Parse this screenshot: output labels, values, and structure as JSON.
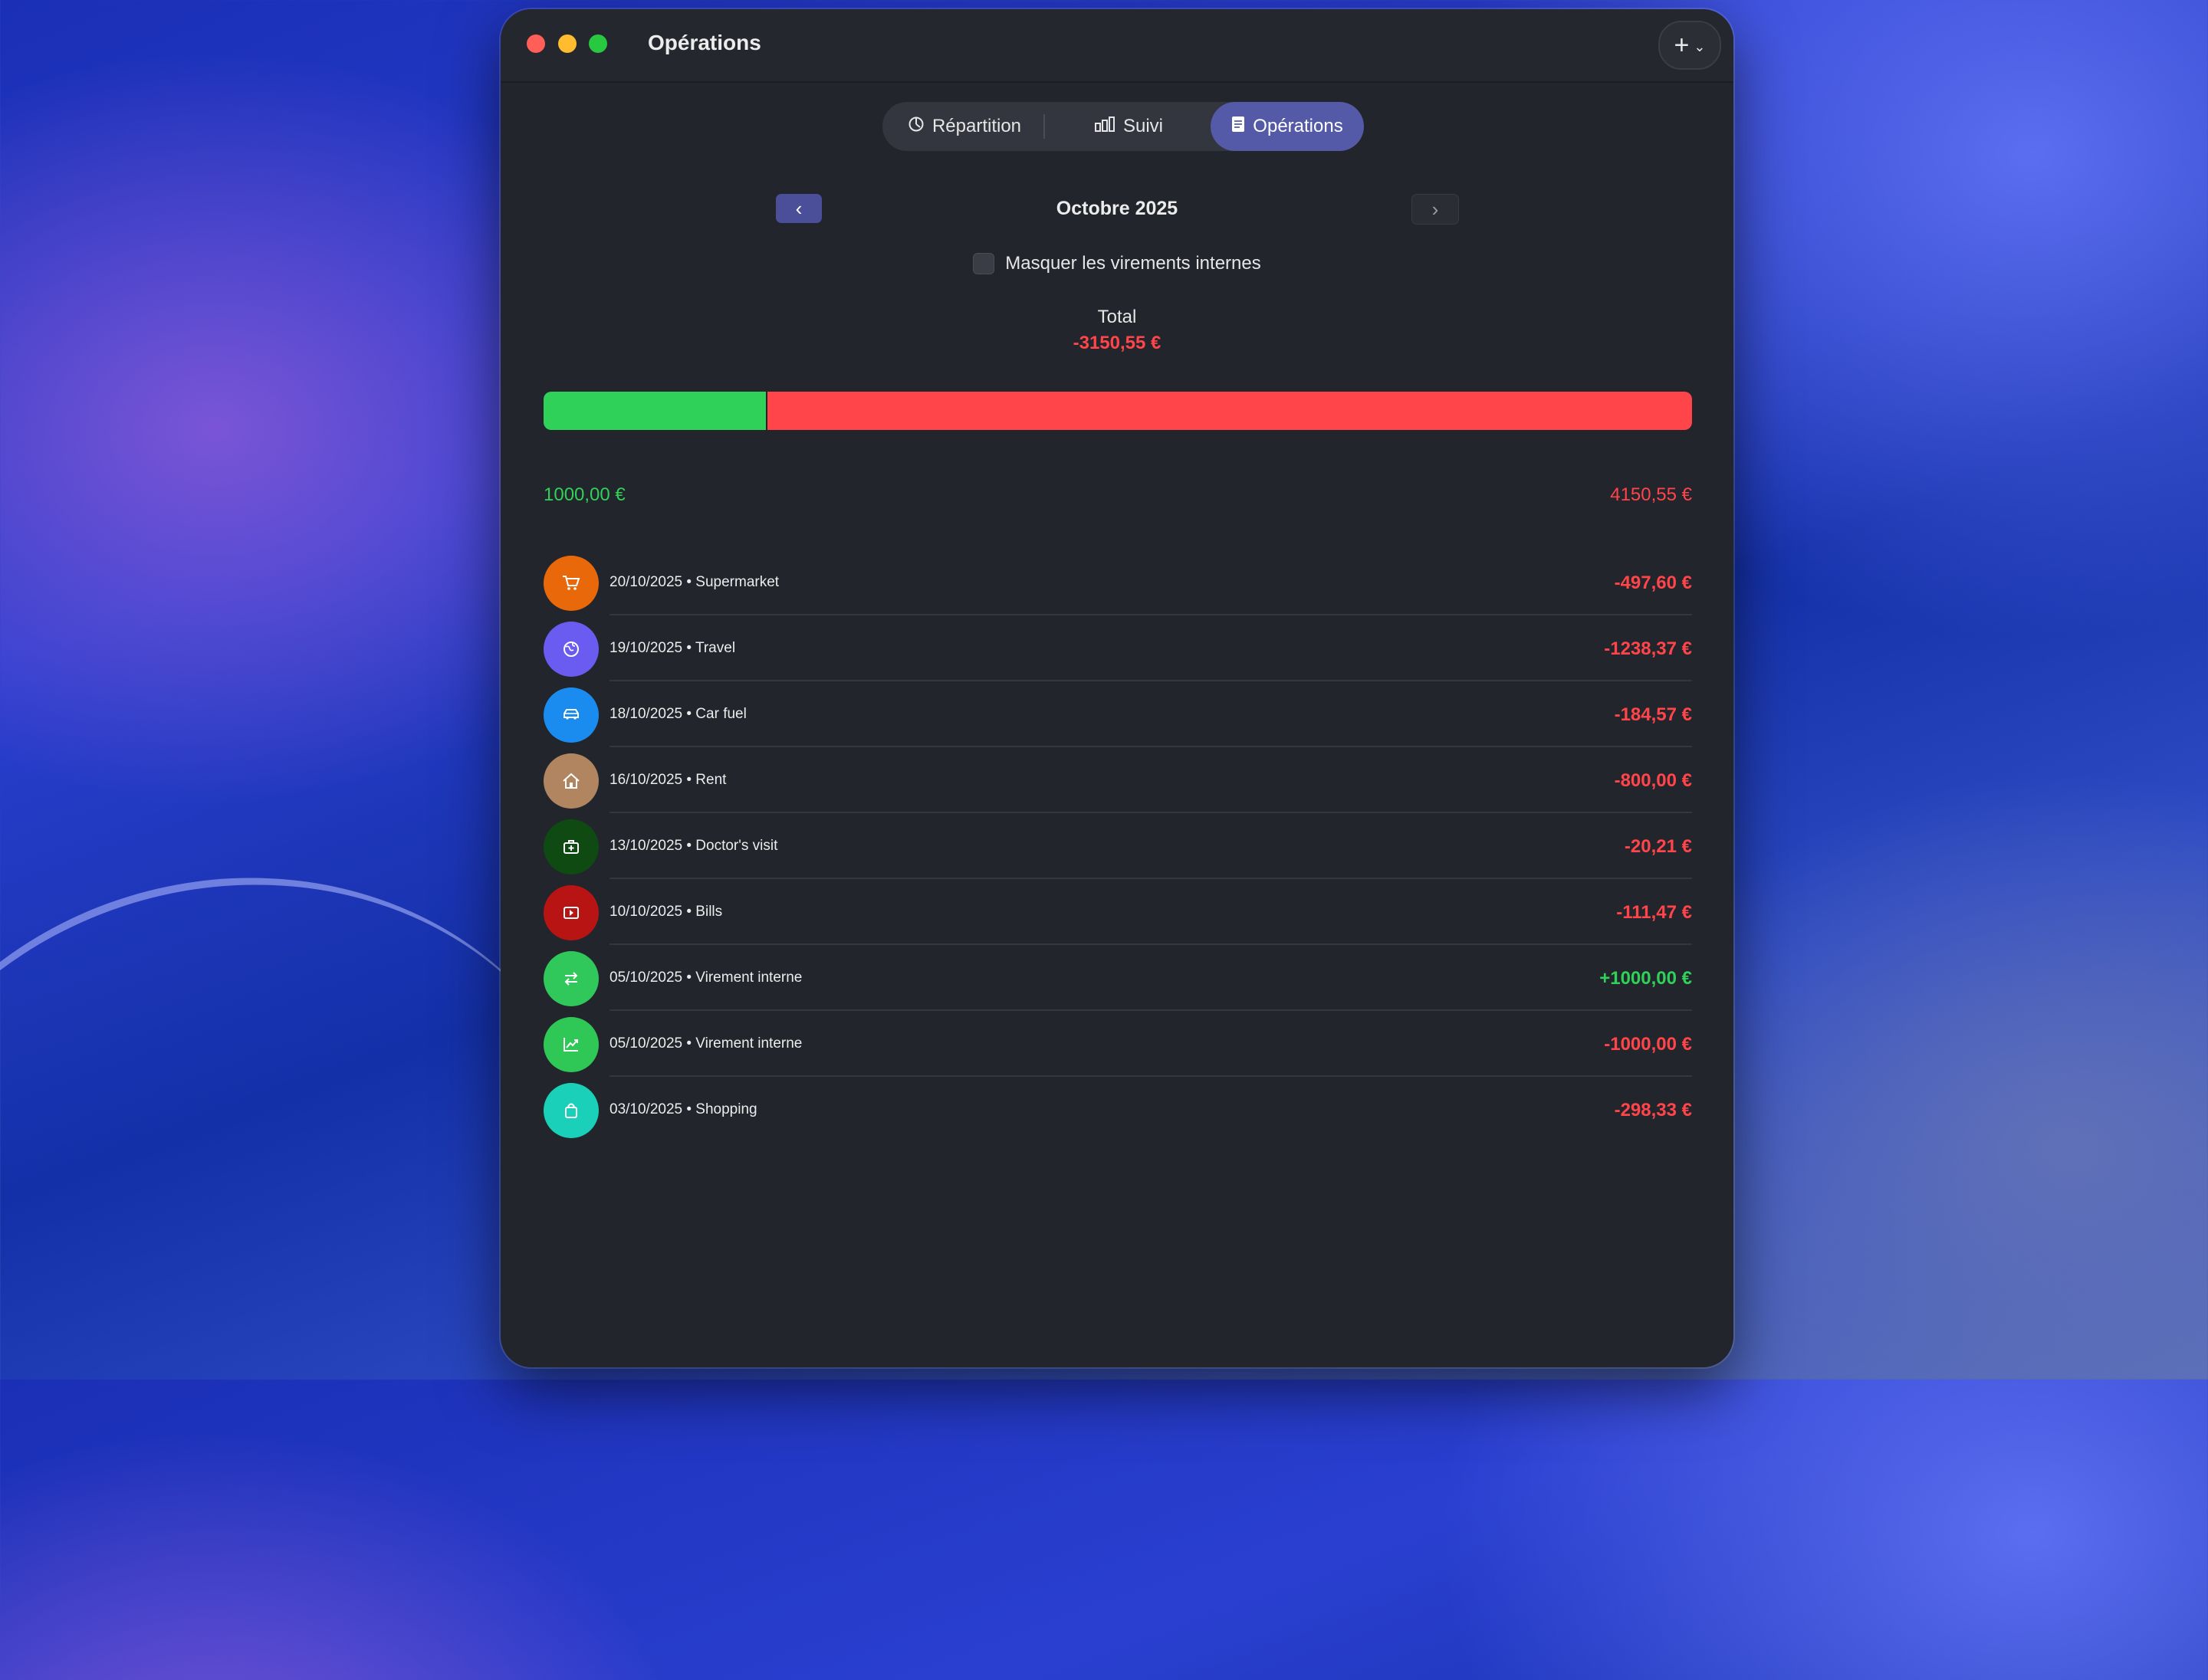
{
  "window": {
    "title": "Opérations"
  },
  "header": {
    "add_button": "+",
    "add_chevron": "⌄"
  },
  "tabs": [
    {
      "label": "Répartition",
      "icon": "pie-chart-icon"
    },
    {
      "label": "Suivi",
      "icon": "bar-chart-icon"
    },
    {
      "label": "Opérations",
      "icon": "document-icon",
      "selected": true
    }
  ],
  "month_nav": {
    "label": "Octobre 2025",
    "prev": "‹",
    "next": "›"
  },
  "filter": {
    "label": "Masquer les virements internes",
    "checked": false
  },
  "total": {
    "label": "Total",
    "value": "-3150,55 €"
  },
  "balance_bar": {
    "income_fraction": 0.194,
    "expense_fraction": 0.806
  },
  "income_total": "1000,00 €",
  "expense_total": "4150,55 €",
  "colors": {
    "income": "#30d158",
    "expense": "#ff4549",
    "accent": "#555aa8"
  },
  "transactions": [
    {
      "desc": "20/10/2025 • Supermarket",
      "amount": "-497,60 €",
      "type": "expense",
      "icon": "cart-icon",
      "color": "#e8680a"
    },
    {
      "desc": "19/10/2025 • Travel",
      "amount": "-1238,37 €",
      "type": "expense",
      "icon": "globe-icon",
      "color": "#6a5cf0"
    },
    {
      "desc": "18/10/2025 • Car fuel",
      "amount": "-184,57 €",
      "type": "expense",
      "icon": "car-icon",
      "color": "#1a8cf0"
    },
    {
      "desc": "16/10/2025 • Rent",
      "amount": "-800,00 €",
      "type": "expense",
      "icon": "house-icon",
      "color": "#b08560"
    },
    {
      "desc": "13/10/2025 • Doctor's visit",
      "amount": "-20,21 €",
      "type": "expense",
      "icon": "medical-kit-icon",
      "color": "#0e4a12"
    },
    {
      "desc": "10/10/2025 • Bills",
      "amount": "-111,47 €",
      "type": "expense",
      "icon": "play-icon",
      "color": "#b81414"
    },
    {
      "desc": "05/10/2025 • Virement interne",
      "amount": "+1000,00 €",
      "type": "income",
      "icon": "transfer-icon",
      "color": "#30c85a"
    },
    {
      "desc": "05/10/2025 • Virement interne",
      "amount": "-1000,00 €",
      "type": "expense",
      "icon": "trend-icon",
      "color": "#2fc856"
    },
    {
      "desc": "03/10/2025 • Shopping",
      "amount": "-298,33 €",
      "type": "expense",
      "icon": "bag-icon",
      "color": "#1ad0b8"
    }
  ]
}
